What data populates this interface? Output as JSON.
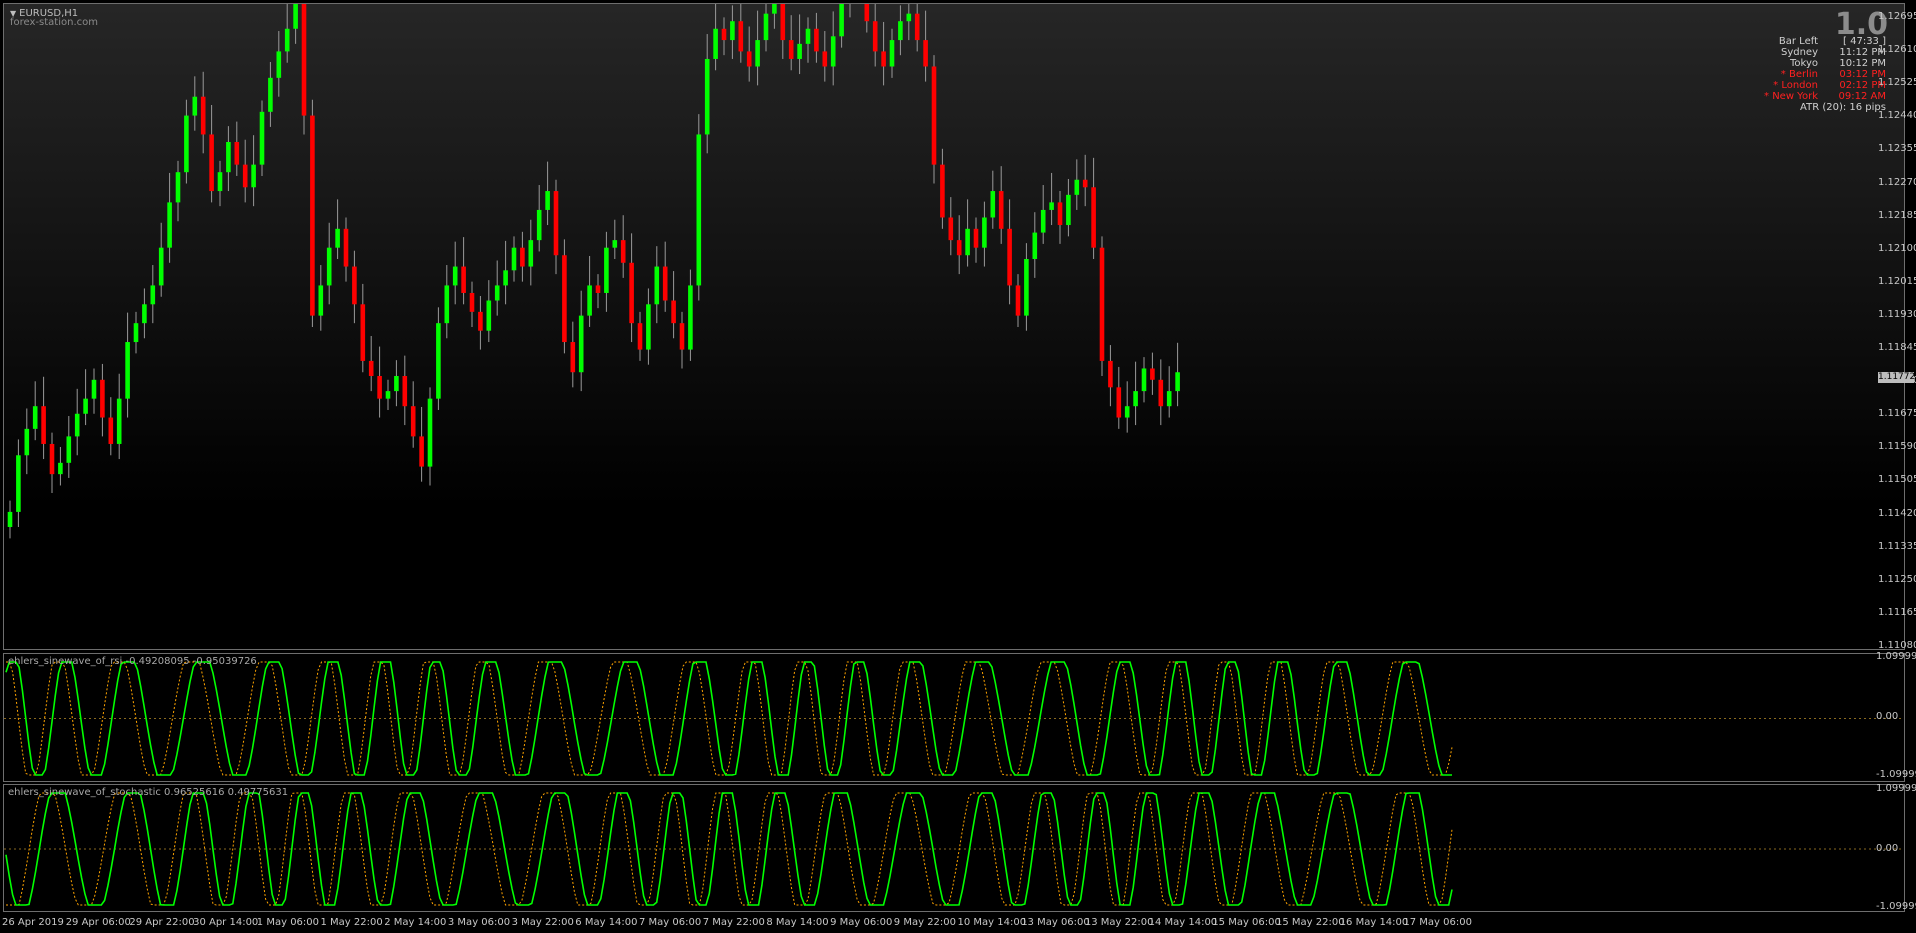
{
  "symbol": "EURUSD,H1",
  "watermark": "forex-station.com",
  "big_value": "1.0",
  "info_rows": [
    {
      "label": "Bar Left",
      "value": "[ 47:33 ]",
      "tone": "white"
    },
    {
      "label": "Sydney",
      "value": "11:12 PM",
      "tone": "white"
    },
    {
      "label": "Tokyo",
      "value": "10:12 PM",
      "tone": "white"
    },
    {
      "label": "* Berlin",
      "value": "03:12 PM",
      "tone": "red"
    },
    {
      "label": "* London",
      "value": "02:12 PM",
      "tone": "red"
    },
    {
      "label": "* New York",
      "value": "09:12 AM",
      "tone": "red"
    }
  ],
  "atr_text": "ATR (20): 16 pips",
  "current_price": "1.11772",
  "price_axis": [
    "1.12695",
    "1.12610",
    "1.12525",
    "1.12440",
    "1.12355",
    "1.12270",
    "1.12185",
    "1.12100",
    "1.12015",
    "1.11930",
    "1.11845",
    "1.11760",
    "1.11675",
    "1.11590",
    "1.11505",
    "1.11420",
    "1.11335",
    "1.11250",
    "1.11165",
    "1.11080"
  ],
  "indicator1": {
    "label": "ehlers_sinewave_of_rsi -0.49208095 -0.95039726",
    "axis": [
      "1.099999",
      "0.00",
      "-1.099999"
    ]
  },
  "indicator2": {
    "label": "ehlers_sinewave_of_stochastic 0.96525616 0.49775631",
    "axis": [
      "1.099999",
      "0.00",
      "-1.099999"
    ]
  },
  "time_axis": [
    "26 Apr 2019",
    "29 Apr 06:00",
    "29 Apr 22:00",
    "30 Apr 14:00",
    "1 May 06:00",
    "1 May 22:00",
    "2 May 14:00",
    "3 May 06:00",
    "3 May 22:00",
    "6 May 14:00",
    "7 May 06:00",
    "7 May 22:00",
    "8 May 14:00",
    "9 May 06:00",
    "9 May 22:00",
    "10 May 14:00",
    "13 May 06:00",
    "13 May 22:00",
    "14 May 14:00",
    "15 May 06:00",
    "15 May 22:00",
    "16 May 14:00",
    "17 May 06:00"
  ],
  "colors": {
    "bull": "#00ff00",
    "bear": "#ff0000",
    "wick": "#9a9a9a",
    "sine": "#00ff00",
    "lead": "#ffa500"
  },
  "chart_data": {
    "type": "candlestick",
    "candle_closes": [
      1.114,
      1.1155,
      1.1162,
      1.1168,
      1.1158,
      1.115,
      1.1153,
      1.116,
      1.1166,
      1.117,
      1.1175,
      1.1165,
      1.1158,
      1.117,
      1.1185,
      1.119,
      1.1195,
      1.12,
      1.121,
      1.1222,
      1.123,
      1.1245,
      1.125,
      1.124,
      1.1225,
      1.123,
      1.1238,
      1.1232,
      1.1226,
      1.1232,
      1.1246,
      1.1255,
      1.1262,
      1.1268,
      1.1275,
      1.1245,
      1.1192,
      1.12,
      1.121,
      1.1215,
      1.1205,
      1.1195,
      1.118,
      1.1176,
      1.117,
      1.1172,
      1.1176,
      1.1168,
      1.116,
      1.1152,
      1.117,
      1.119,
      1.12,
      1.1205,
      1.1198,
      1.1193,
      1.1188,
      1.1196,
      1.12,
      1.1204,
      1.121,
      1.1205,
      1.1212,
      1.122,
      1.1225,
      1.1208,
      1.1185,
      1.1177,
      1.1192,
      1.12,
      1.1198,
      1.121,
      1.1212,
      1.1206,
      1.119,
      1.1183,
      1.1195,
      1.1205,
      1.1196,
      1.119,
      1.1183,
      1.12,
      1.124,
      1.126,
      1.1268,
      1.1265,
      1.127,
      1.1262,
      1.1258,
      1.1265,
      1.1272,
      1.1278,
      1.1265,
      1.126,
      1.1264,
      1.1268,
      1.1262,
      1.1258,
      1.1266,
      1.1275,
      1.13,
      1.129,
      1.127,
      1.1262,
      1.1258,
      1.1265,
      1.127,
      1.1272,
      1.1265,
      1.1258,
      1.1232,
      1.1218,
      1.1212,
      1.1208,
      1.1215,
      1.121,
      1.1218,
      1.1225,
      1.1215,
      1.12,
      1.1192,
      1.1207,
      1.1214,
      1.122,
      1.1222,
      1.1216,
      1.1224,
      1.1228,
      1.1226,
      1.121,
      1.118,
      1.1173,
      1.1165,
      1.1168,
      1.1172,
      1.1178,
      1.1175,
      1.1168,
      1.1172,
      1.1177
    ],
    "sinewave_rsi": {
      "main_last": -0.49208095,
      "lead_last": -0.95039726
    },
    "sinewave_stochastic": {
      "main_last": 0.96525616,
      "lead_last": 0.49775631
    }
  }
}
